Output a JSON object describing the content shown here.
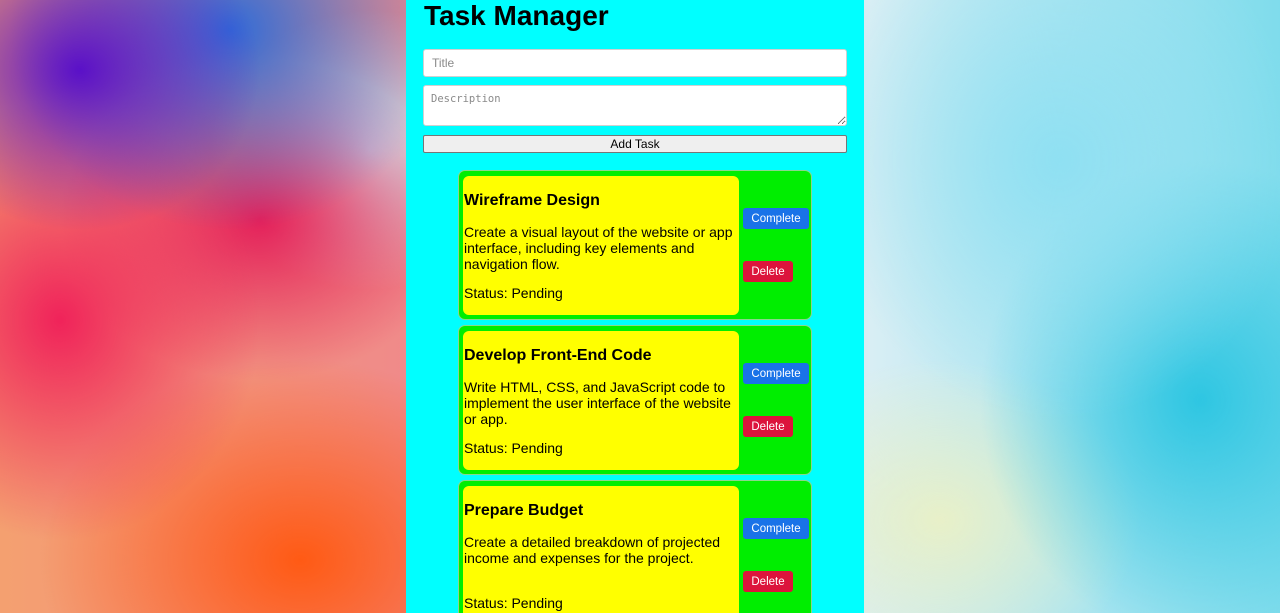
{
  "app": {
    "title": "Task Manager"
  },
  "form": {
    "title_placeholder": "Title",
    "title_value": "",
    "description_placeholder": "Description",
    "description_value": "",
    "add_label": "Add Task"
  },
  "tasks": [
    {
      "title": "Wireframe Design",
      "description": "Create a visual layout of the website or app interface, including key elements and navigation flow.",
      "status": "Status: Pending",
      "complete_label": "Complete",
      "delete_label": "Delete"
    },
    {
      "title": "Develop Front-End Code",
      "description": "Write HTML, CSS, and JavaScript code to implement the user interface of the website or app.",
      "status": "Status: Pending",
      "complete_label": "Complete",
      "delete_label": "Delete"
    },
    {
      "title": "Prepare Budget",
      "description": "Create a detailed breakdown of projected income and expenses for the project.",
      "status": "Status: Pending",
      "complete_label": "Complete",
      "delete_label": "Delete"
    }
  ],
  "colors": {
    "container": "#00ffff",
    "card": "#00ee00",
    "card_body": "#ffff00",
    "complete_button": "#1a73e8",
    "delete_button": "#dc143c"
  }
}
